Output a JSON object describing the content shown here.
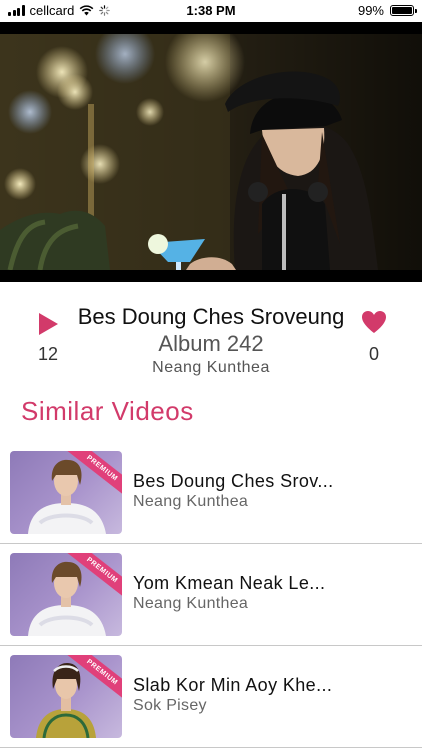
{
  "status_bar": {
    "carrier": "cellcard",
    "time": "1:38 PM",
    "battery": "99%",
    "battery_level": 0.99
  },
  "video": {
    "icons": [
      "play-icon"
    ]
  },
  "song": {
    "title": "Bes Doung Ches Sroveung",
    "subtitle": "Album 242",
    "artist": "Neang Kunthea",
    "plays": "12",
    "likes": "0",
    "accent_color": "#d23a6a"
  },
  "similar": {
    "heading": "Similar Videos",
    "badge": "PREMIUM",
    "items": [
      {
        "title": "Bes Doung Ches Srov...",
        "artist": "Neang Kunthea"
      },
      {
        "title": "Yom Kmean Neak Le...",
        "artist": "Neang Kunthea"
      },
      {
        "title": "Slab Kor Min Aoy Khe...",
        "artist": "Sok Pisey"
      }
    ]
  }
}
